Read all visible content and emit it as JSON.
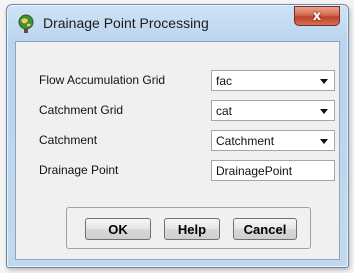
{
  "window": {
    "title": "Drainage Point Processing",
    "close_label": "x",
    "app_icon": "arcgis-globe-icon"
  },
  "form": {
    "rows": [
      {
        "label": "Flow Accumulation Grid",
        "type": "select",
        "value": "fac"
      },
      {
        "label": "Catchment Grid",
        "type": "select",
        "value": "cat"
      },
      {
        "label": "Catchment",
        "type": "select",
        "value": "Catchment"
      },
      {
        "label": "Drainage Point",
        "type": "text",
        "value": "DrainagePoint"
      }
    ]
  },
  "buttons": {
    "ok_label": "OK",
    "help_label": "Help",
    "cancel_label": "Cancel"
  },
  "colors": {
    "titlebar": "#b9d4ee",
    "close_button": "#c0402a",
    "client_bg": "#f0f0f0"
  }
}
